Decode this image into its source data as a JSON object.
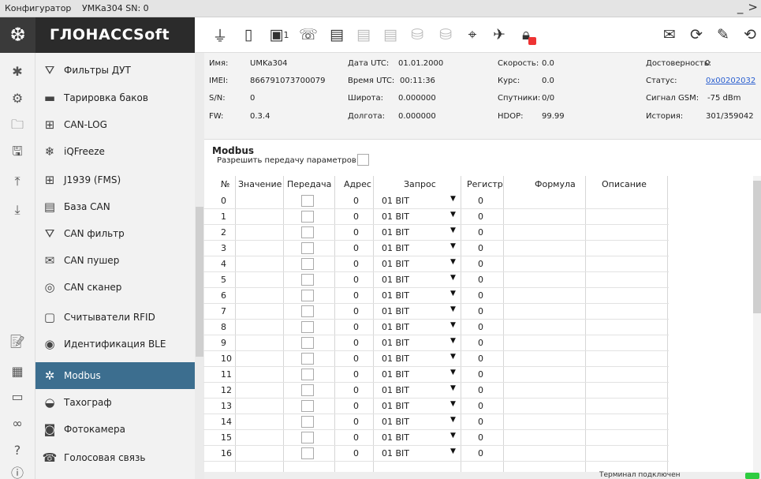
{
  "window": {
    "app_name": "Конфигуратор",
    "device": "УМКа304 SN: 0",
    "minimize": "_",
    "more": ">"
  },
  "brand": "ГЛОНАССSoft",
  "toolbar": {
    "sim_label": "1",
    "icons": [
      "power-plug-icon",
      "sim-card-icon",
      "sim-1-icon",
      "wifi-phone-icon",
      "device-check-icon",
      "device-upload-icon",
      "device-download-icon",
      "database-icon",
      "database-settings-icon",
      "location-off-icon",
      "satellite-icon",
      "lock-icon",
      "mail-icon",
      "refresh-icon",
      "signature-icon",
      "sync-icon"
    ]
  },
  "rail": {
    "icons": [
      "bluetooth-icon",
      "server-icon",
      "folder-icon",
      "save-icon",
      "upload-icon",
      "download-icon",
      "script-icon",
      "table-icon",
      "can-icon",
      "plug-link-icon",
      "help-icon",
      "info-icon"
    ]
  },
  "sidebar": {
    "items": [
      {
        "label": "Фильтры ДУТ",
        "icon": "filter-icon"
      },
      {
        "label": "Тарировка баков",
        "icon": "tank-icon"
      },
      {
        "label": "CAN-LOG",
        "icon": "connector-icon"
      },
      {
        "label": "iQFreeze",
        "icon": "snowflake-icon"
      },
      {
        "label": "J1939 (FMS)",
        "icon": "connector-icon"
      },
      {
        "label": "База CAN",
        "icon": "can-base-icon"
      },
      {
        "label": "CAN фильтр",
        "icon": "can-filter-icon"
      },
      {
        "label": "CAN пушер",
        "icon": "can-pusher-icon"
      },
      {
        "label": "CAN сканер",
        "icon": "can-scanner-icon"
      },
      {
        "label": "Считыватели RFID",
        "icon": "rfid-icon"
      },
      {
        "label": "Идентификация BLE",
        "icon": "ble-icon"
      },
      {
        "label": "Modbus",
        "icon": "modbus-icon",
        "active": true
      },
      {
        "label": "Тахограф",
        "icon": "tachograph-icon"
      },
      {
        "label": "Фотокамера",
        "icon": "camera-icon"
      },
      {
        "label": "Голосовая связь",
        "icon": "phone-icon"
      }
    ]
  },
  "info": {
    "name_label": "Имя:",
    "name": "UMKa304",
    "imei_label": "IMEI:",
    "imei": "866791073700079",
    "sn_label": "S/N:",
    "sn": "0",
    "fw_label": "FW:",
    "fw": "0.3.4",
    "date_label": "Дата UTC:",
    "date": "01.01.2000",
    "time_label": "Время UTC:",
    "time": "00:11:36",
    "lat_label": "Широта:",
    "lat": "0.000000",
    "lon_label": "Долгота:",
    "lon": "0.000000",
    "speed_label": "Скорость:",
    "speed": "0.0",
    "course_label": "Курс:",
    "course": "0.0",
    "sats_label": "Спутники:",
    "sats": "0/0",
    "hdop_label": "HDOP:",
    "hdop": "99.99",
    "valid_label": "Достоверность:",
    "valid": "0",
    "status_label": "Статус:",
    "status": "0x00202032",
    "gsm_label": "Сигнал GSM:",
    "gsm": "-75 dBm",
    "history_label": "История:",
    "history": "301/359042"
  },
  "modbus": {
    "title": "Modbus",
    "allow_label": "Разрешить передачу параметров:"
  },
  "table": {
    "headers": [
      "№",
      "Значение",
      "Передача",
      "Адрес",
      "Запрос",
      "Регистр",
      "Формула",
      "Описание"
    ],
    "default_address": "0",
    "default_request": "01 BIT",
    "default_register": "0",
    "rows": [
      "0",
      "1",
      "2",
      "3",
      "4",
      "5",
      "6",
      "7",
      "8",
      "9",
      "10",
      "11",
      "12",
      "13",
      "14",
      "15",
      "16"
    ]
  },
  "status": {
    "text": "Терминал подключен",
    "led_color": "#2ecc40"
  }
}
